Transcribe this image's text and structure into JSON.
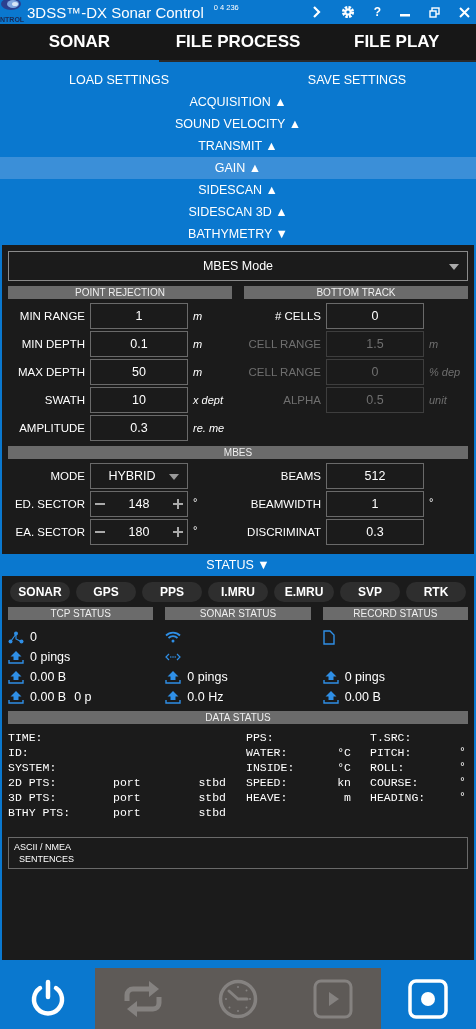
{
  "window": {
    "logo_text": "NTROL",
    "title": "3DSS™-DX Sonar Control",
    "version": "0 4 236",
    "help_button": "?"
  },
  "tabs": [
    {
      "label": "SONAR",
      "selected": true
    },
    {
      "label": "FILE PROCESS",
      "selected": false
    },
    {
      "label": "FILE PLAY",
      "selected": false
    }
  ],
  "settings_actions": [
    "LOAD SETTINGS",
    "SAVE SETTINGS"
  ],
  "sections": [
    {
      "label": "ACQUISITION ▲",
      "highlighted": false
    },
    {
      "label": "SOUND VELOCITY ▲",
      "highlighted": false
    },
    {
      "label": "TRANSMIT ▲",
      "highlighted": false
    },
    {
      "label": "GAIN ▲",
      "highlighted": true
    },
    {
      "label": "SIDESCAN ▲",
      "highlighted": false
    },
    {
      "label": "SIDESCAN 3D ▲",
      "highlighted": false
    },
    {
      "label": "BATHYMETRY ▼",
      "highlighted": false
    }
  ],
  "bathymetry": {
    "mode_dropdown": "MBES Mode",
    "point_rejection": {
      "title": "POINT REJECTION",
      "rows": [
        {
          "label": "MIN RANGE",
          "value": "1",
          "unit": "m",
          "disabled": false
        },
        {
          "label": "MIN DEPTH",
          "value": "0.1",
          "unit": "m",
          "disabled": false
        },
        {
          "label": "MAX DEPTH",
          "value": "50",
          "unit": "m",
          "disabled": false
        },
        {
          "label": "SWATH",
          "value": "10",
          "unit": "x dept",
          "disabled": false
        },
        {
          "label": "AMPLITUDE",
          "value": "0.3",
          "unit": "re. me",
          "disabled": false
        }
      ]
    },
    "bottom_track": {
      "title": "BOTTOM TRACK",
      "rows": [
        {
          "label": "# CELLS",
          "value": "0",
          "disabled": false
        },
        {
          "label": "CELL RANGE",
          "value": "1.5",
          "unit": "m",
          "disabled": true
        },
        {
          "label": "CELL RANGE",
          "value": "0",
          "unit": "% dep",
          "disabled": true
        },
        {
          "label": "ALPHA",
          "value": "0.5",
          "unit": "unit",
          "disabled": true
        }
      ]
    },
    "mbes": {
      "title": "MBES",
      "rows_left": [
        {
          "kind": "dropdown",
          "label": "MODE",
          "value": "HYBRID"
        },
        {
          "kind": "stepper",
          "label": "ED. SECTOR",
          "value": "148",
          "unit": "°"
        },
        {
          "kind": "stepper",
          "label": "EA. SECTOR",
          "value": "180",
          "unit": "°"
        }
      ],
      "rows_right": [
        {
          "label": "BEAMS",
          "value": "512"
        },
        {
          "label": "BEAMWIDTH",
          "value": "1",
          "unit": "°"
        },
        {
          "label": "DISCRIMINAT",
          "value": "0.3"
        }
      ]
    }
  },
  "status": {
    "label": "STATUS ▼",
    "devices": [
      "SONAR",
      "GPS",
      "PPS",
      "I.MRU",
      "E.MRU",
      "SVP",
      "RTK"
    ],
    "columns": [
      {
        "title": "TCP STATUS",
        "rows": [
          {
            "kind": "network",
            "texts": [
              "0"
            ]
          },
          {
            "kind": "upload",
            "texts": [
              "0 pings"
            ]
          },
          {
            "kind": "upload",
            "texts": [
              "0.00 B"
            ]
          },
          {
            "kind": "upload",
            "texts": [
              "0.00 B",
              "0 p"
            ]
          }
        ]
      },
      {
        "title": "SONAR STATUS",
        "rows": [
          {
            "kind": "wifi",
            "texts": []
          },
          {
            "kind": "link",
            "texts": []
          },
          {
            "kind": "upload",
            "texts": [
              "0 pings"
            ]
          },
          {
            "kind": "upload",
            "texts": [
              "0.0 Hz"
            ]
          }
        ]
      },
      {
        "title": "RECORD STATUS",
        "rows": [
          {
            "kind": "file",
            "texts": []
          },
          {
            "kind": "blank",
            "texts": []
          },
          {
            "kind": "upload",
            "texts": [
              "0 pings"
            ]
          },
          {
            "kind": "upload",
            "texts": [
              "0.00 B"
            ]
          }
        ]
      }
    ],
    "data_status": {
      "title": "DATA STATUS",
      "left": [
        {
          "label": "TIME:"
        },
        {
          "label": "ID:"
        },
        {
          "label": "SYSTEM:"
        },
        {
          "label": "2D PTS:",
          "port": "port",
          "stbd": "stbd"
        },
        {
          "label": "3D PTS:",
          "port": "port",
          "stbd": "stbd"
        },
        {
          "label": "BTHY PTS:",
          "port": "port",
          "stbd": "stbd"
        }
      ],
      "middle": [
        {
          "label": "PPS:"
        },
        {
          "label": "WATER:",
          "unit": "°C"
        },
        {
          "label": "INSIDE:",
          "unit": "°C"
        },
        {
          "label": "SPEED:",
          "unit": "kn"
        },
        {
          "label": "HEAVE:",
          "unit": "m"
        }
      ],
      "right": [
        {
          "label": "T.SRC:"
        },
        {
          "label": "PITCH:",
          "unit": "°"
        },
        {
          "label": "ROLL:",
          "unit": "°"
        },
        {
          "label": "COURSE:",
          "unit": "°"
        },
        {
          "label": "HEADING:",
          "unit": "°"
        }
      ]
    },
    "nmea_lines": [
      "ASCII / NMEA",
      "SENTENCES"
    ]
  },
  "toolbar": [
    {
      "kind": "power",
      "active": true
    },
    {
      "kind": "repeat",
      "active": false
    },
    {
      "kind": "clock",
      "active": false
    },
    {
      "kind": "play",
      "active": false
    },
    {
      "kind": "record",
      "active": true
    }
  ]
}
